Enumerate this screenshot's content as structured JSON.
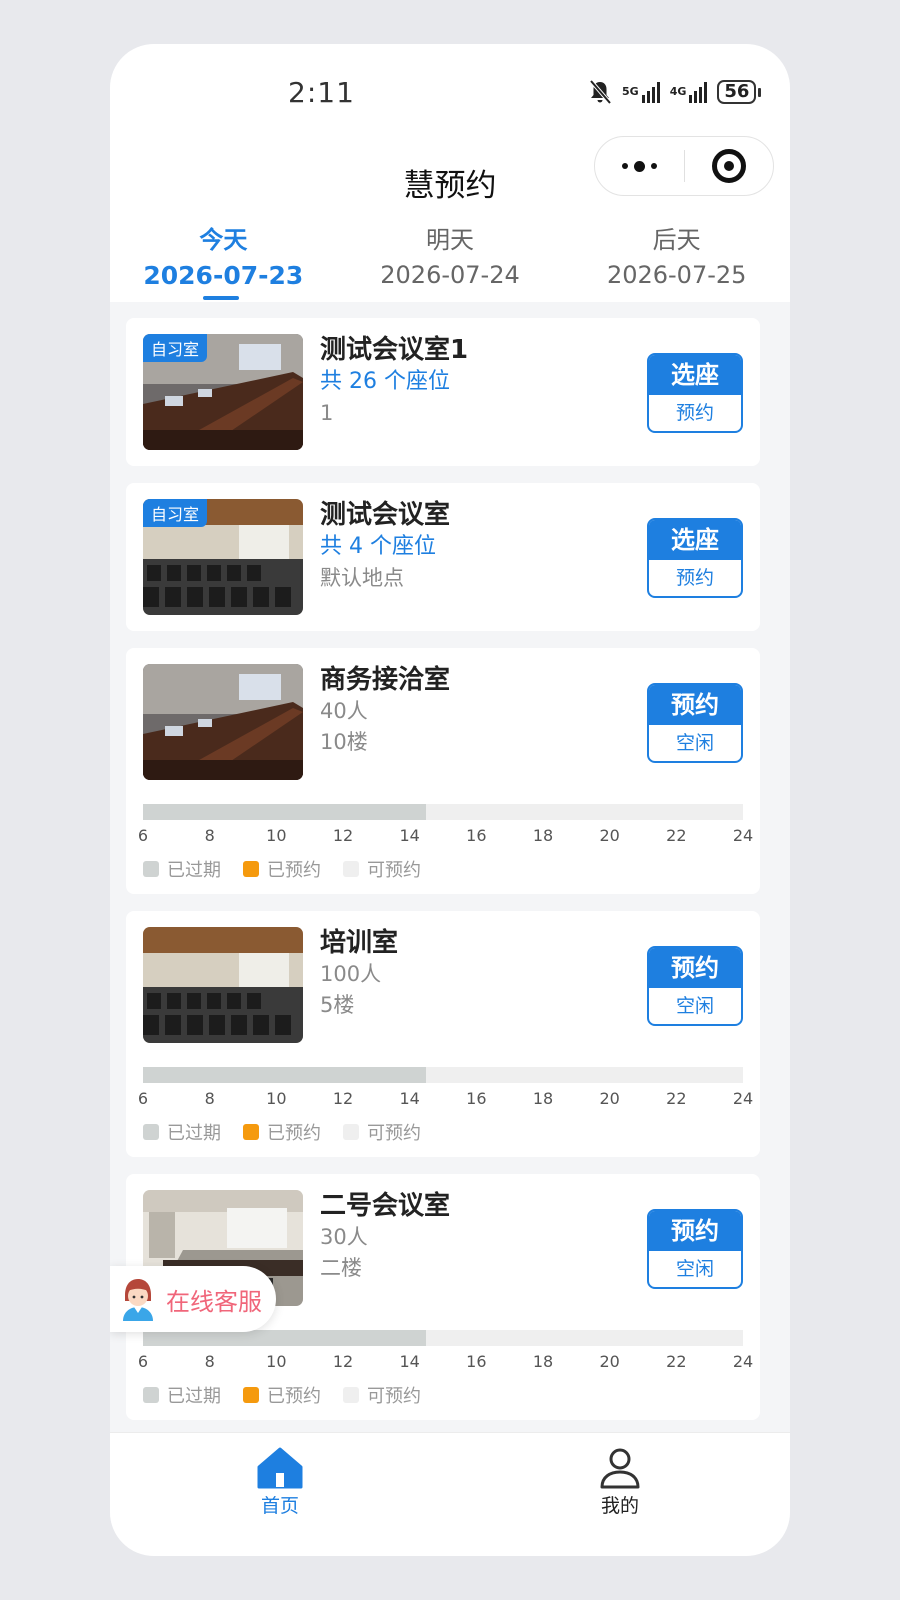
{
  "status_bar": {
    "time": "2:11",
    "net_5g": "5G",
    "net_4g": "4G",
    "battery": "56"
  },
  "nav": {
    "title": "慧预约"
  },
  "date_tabs": [
    {
      "label": "今天",
      "date": "2026-07-23"
    },
    {
      "label": "明天",
      "date": "2026-07-24"
    },
    {
      "label": "后天",
      "date": "2026-07-25"
    }
  ],
  "rooms": [
    {
      "tag": "自习室",
      "name": "测试会议室1",
      "seats": "共 26 个座位",
      "line": "1",
      "btn_top": "选座",
      "btn_bottom": "预约"
    },
    {
      "tag": "自习室",
      "name": "测试会议室",
      "seats": "共 4 个座位",
      "line": "默认地点",
      "btn_top": "选座",
      "btn_bottom": "预约"
    },
    {
      "name": "商务接洽室",
      "capacity": "40人",
      "floor": "10楼",
      "btn_top": "预约",
      "btn_bottom": "空闲",
      "expired_until_hour": 14.5
    },
    {
      "name": "培训室",
      "capacity": "100人",
      "floor": "5楼",
      "btn_top": "预约",
      "btn_bottom": "空闲",
      "expired_until_hour": 14.5
    },
    {
      "name": "二号会议室",
      "capacity": "30人",
      "floor": "二楼",
      "btn_top": "预约",
      "btn_bottom": "空闲",
      "expired_until_hour": 14.5
    }
  ],
  "timeline": {
    "hours": [
      "6",
      "8",
      "10",
      "12",
      "14",
      "16",
      "18",
      "20",
      "22",
      "24"
    ],
    "range": [
      6,
      24
    ],
    "legend": [
      {
        "label": "已过期",
        "color": "#cfd3d2"
      },
      {
        "label": "已预约",
        "color": "#f59a0e"
      },
      {
        "label": "可预约",
        "color": "#efefef"
      }
    ]
  },
  "service": {
    "label": "在线客服"
  },
  "tab_bar": [
    {
      "label": "首页",
      "icon": "home-icon"
    },
    {
      "label": "我的",
      "icon": "user-icon"
    }
  ],
  "colors": {
    "accent": "#1e7fe0",
    "service_text": "#f0667a"
  }
}
